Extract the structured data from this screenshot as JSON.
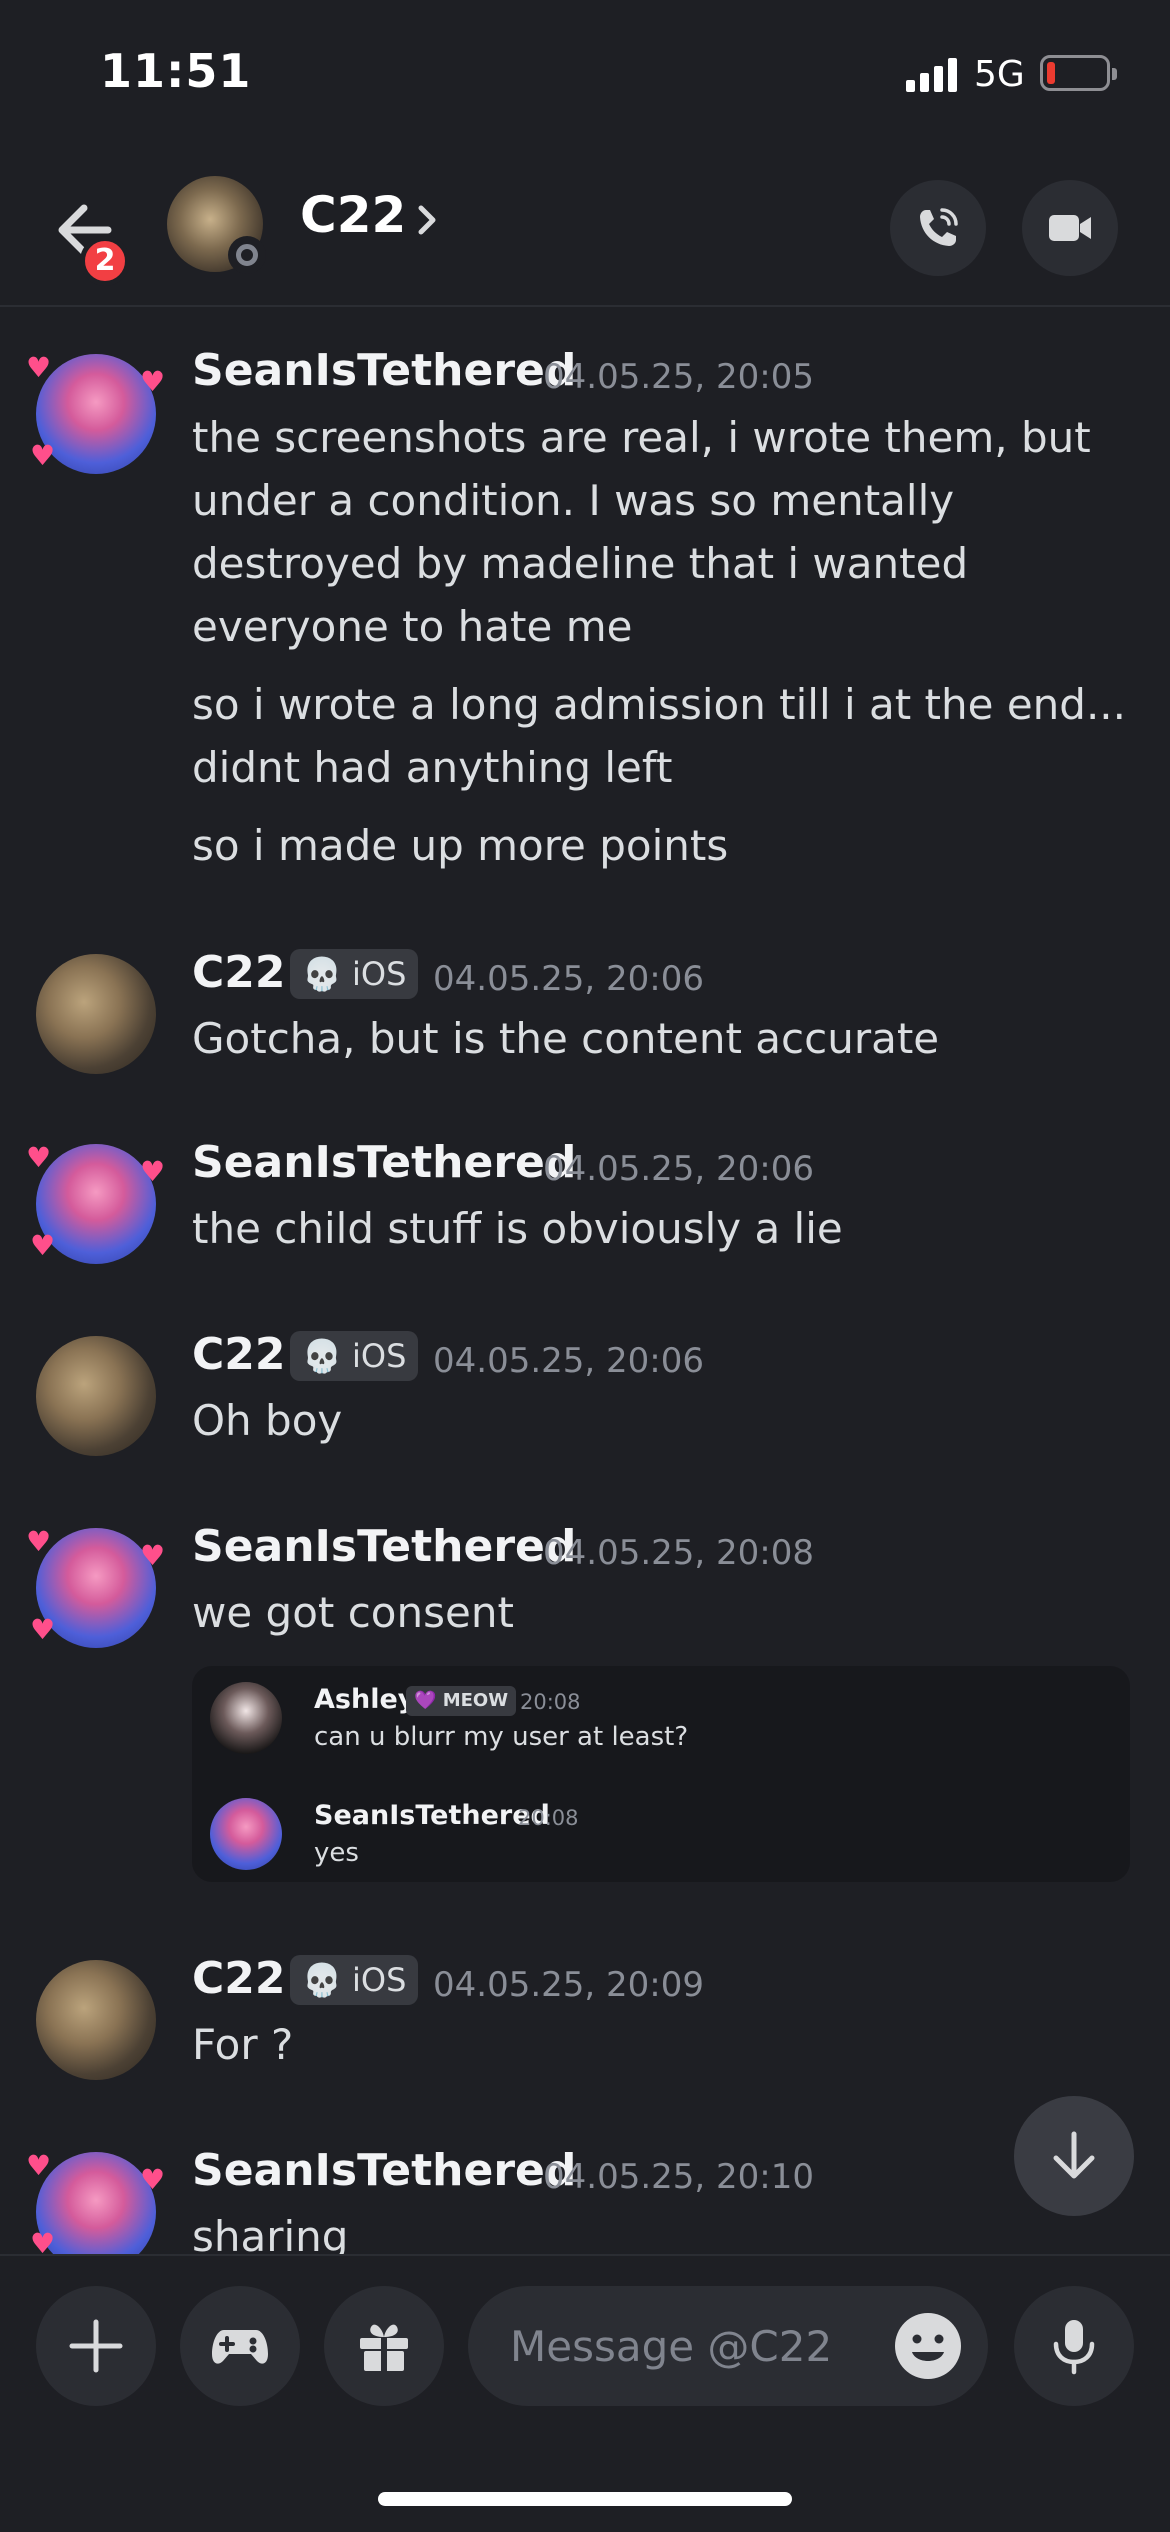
{
  "status_bar": {
    "time": "11:51",
    "network": "5G"
  },
  "header": {
    "unread_count": "2",
    "title": "C22"
  },
  "messages": [
    {
      "author": "SeanIsTethered",
      "timestamp": "04.05.25, 20:05",
      "lines": [
        "the screenshots are real, i wrote them, but under a condition. I was so mentally destroyed by madeline that i wanted everyone to hate me",
        "so i wrote a long admission till i at the end... didnt had anything left",
        "so i made up more points"
      ]
    },
    {
      "author": "C22",
      "tag": "iOS",
      "timestamp": "04.05.25, 20:06",
      "text": "Gotcha, but is the content accurate"
    },
    {
      "author": "SeanIsTethered",
      "timestamp": "04.05.25, 20:06",
      "text": "the child stuff is obviously a lie"
    },
    {
      "author": "C22",
      "tag": "iOS",
      "timestamp": "04.05.25, 20:06",
      "text": "Oh boy"
    },
    {
      "author": "SeanIsTethered",
      "timestamp": "04.05.25, 20:08",
      "text": "we got consent",
      "attachment": {
        "messages": [
          {
            "author": "Ashley",
            "tag": "MEOW",
            "time": "20:08",
            "text": "can u blurr my user at least?"
          },
          {
            "author": "SeanIsTethered",
            "time": "20:08",
            "text": "yes"
          }
        ]
      }
    },
    {
      "author": "C22",
      "tag": "iOS",
      "timestamp": "04.05.25, 20:09",
      "text": "For ?"
    },
    {
      "author": "SeanIsTethered",
      "timestamp": "04.05.25, 20:10",
      "text": "sharing"
    }
  ],
  "composer": {
    "placeholder": "Message @C22"
  },
  "colors": {
    "background": "#1e1f24",
    "surface": "#2b2d33",
    "badge_red": "#f23f43",
    "timestamp": "#8a8e97"
  }
}
